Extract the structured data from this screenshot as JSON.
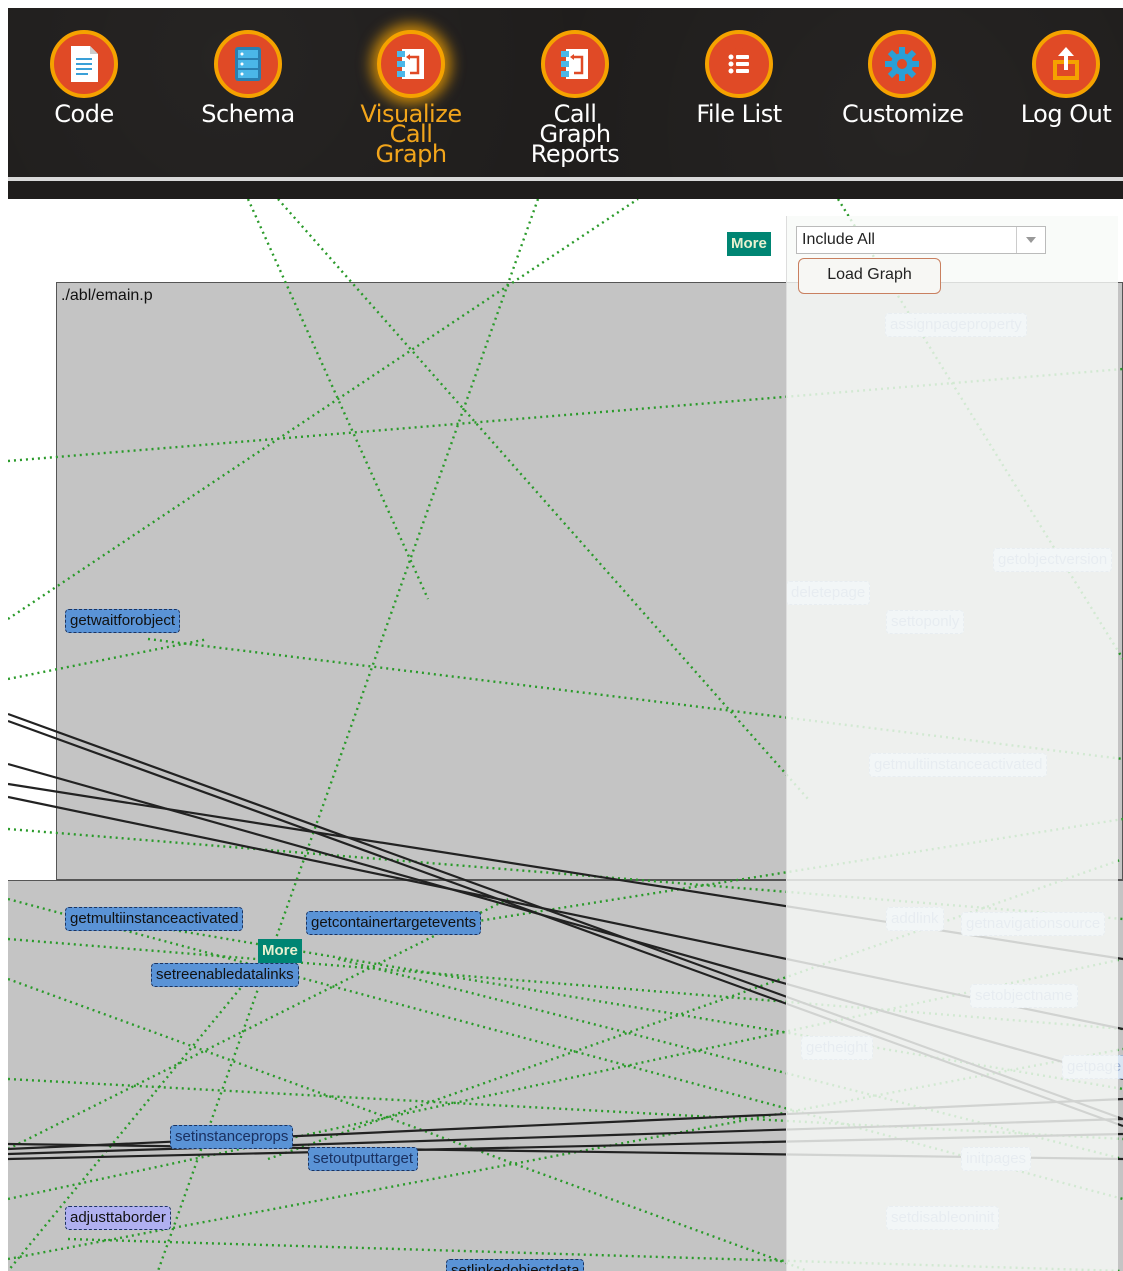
{
  "toolbar": {
    "items": [
      {
        "label": "Code",
        "icon": "document-icon"
      },
      {
        "label": "Schema",
        "icon": "schema-icon"
      },
      {
        "label": "Visualize Call Graph",
        "label_line1": "Visualize",
        "label_line2": "Call Graph",
        "icon": "call-graph-icon",
        "active": true
      },
      {
        "label": "Call Graph Reports",
        "label_line1": "Call Graph",
        "label_line2": "Reports",
        "icon": "call-graph-report-icon"
      },
      {
        "label": "File List",
        "icon": "list-icon"
      },
      {
        "label": "Customize",
        "icon": "gear-icon"
      },
      {
        "label": "Log Out",
        "icon": "logout-icon"
      }
    ],
    "colors": {
      "background": "#1f1d1c",
      "icon_fill": "#e04a26",
      "icon_ring": "#f5a200",
      "active_label": "#f2a51b"
    }
  },
  "panel": {
    "more_label": "More",
    "include_select": {
      "value": "Include All"
    },
    "load_graph_label": "Load Graph"
  },
  "graph": {
    "module_title": "./abl/emain.p",
    "more_label": "More",
    "nodes": [
      "getwaitforobject",
      "getmultiinstanceactivated",
      "getcontainertargetevents",
      "setreenabledatalinks",
      "setinstanceprops",
      "setoutputtarget",
      "adjusttaborder",
      "setlinkedobjectdata",
      "assignpageproperty",
      "getobjectversion",
      "deletepage",
      "settoponly",
      "getmultiinstanceactivated",
      "addlink",
      "getnavigationsource",
      "setobjectname",
      "getheight",
      "getpage",
      "initpages",
      "setdisableoninit"
    ],
    "colors": {
      "edge_dotted": "#2a9a2a",
      "edge_solid": "#333333",
      "node_blue": "#5a93d6",
      "node_violet": "#b0b0f0",
      "more_button": "#008573"
    }
  }
}
